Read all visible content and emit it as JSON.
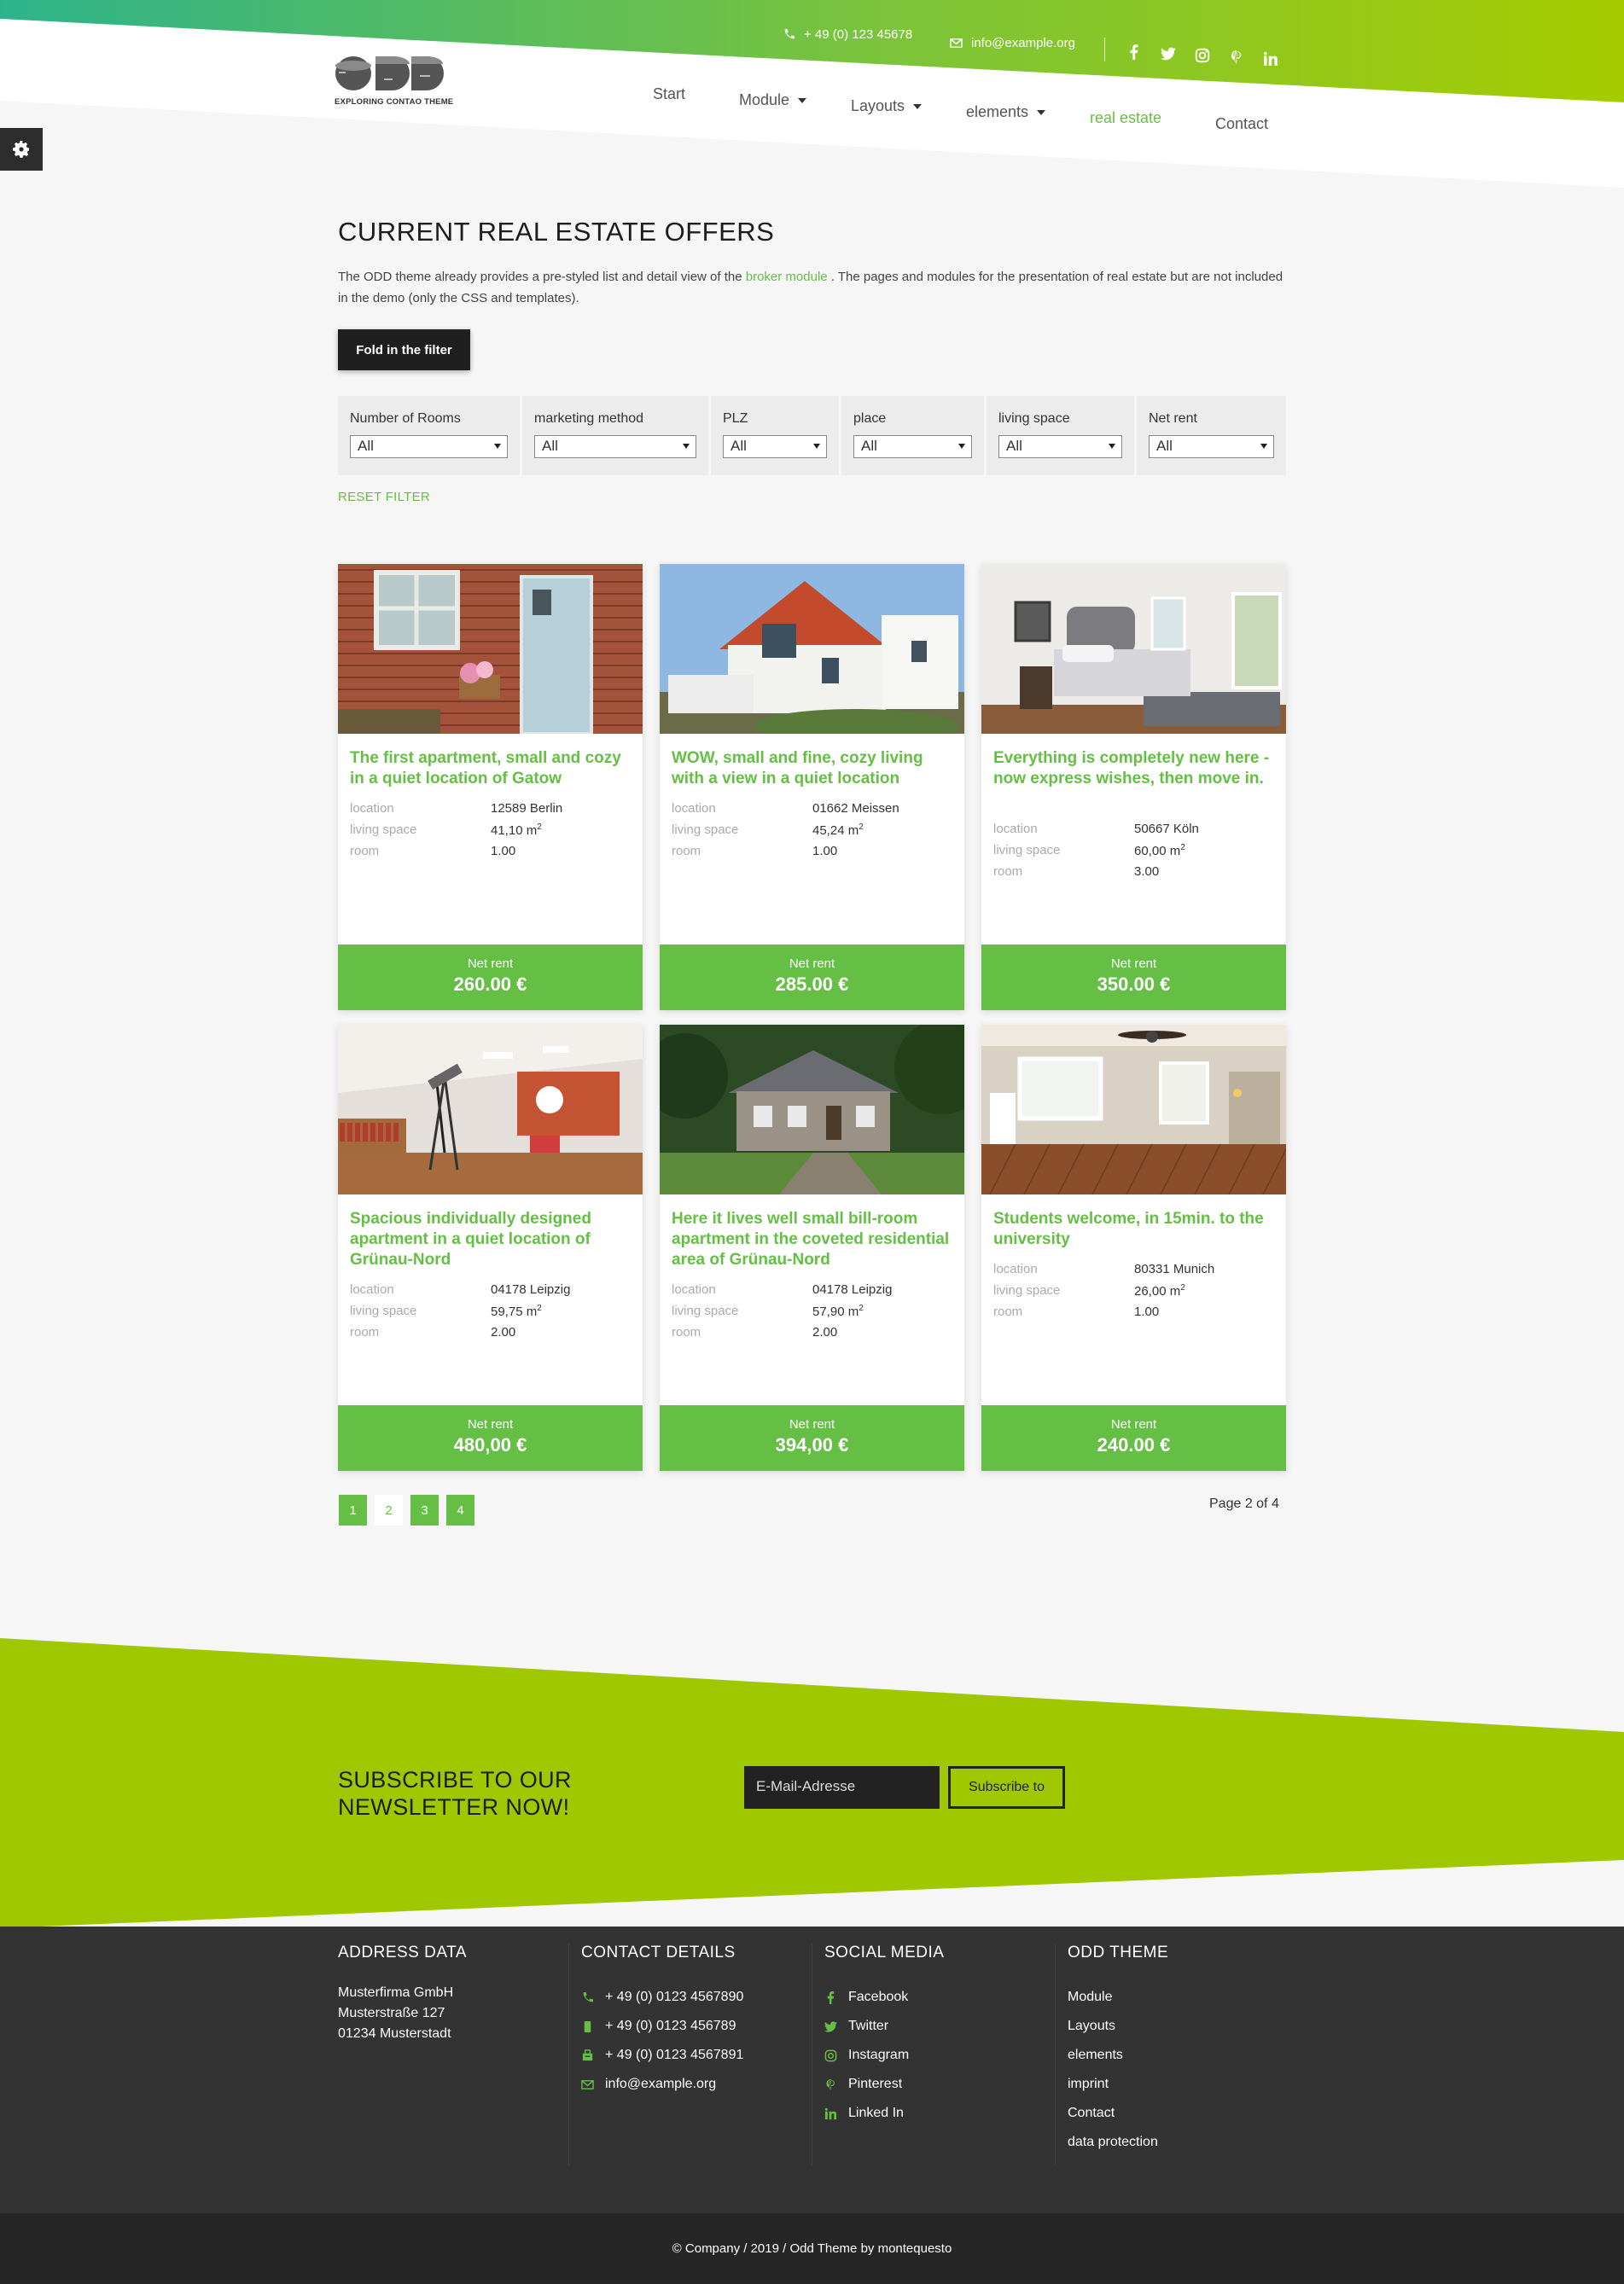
{
  "colors": {
    "accent": "#66bf45",
    "lime": "#a0c800",
    "teal": "#2db38b",
    "dark": "#333333"
  },
  "topbar": {
    "phone": "+ 49 (0) 123 45678",
    "email": "info@example.org",
    "social": [
      "facebook-icon",
      "twitter-icon",
      "instagram-icon",
      "pinterest-icon",
      "linkedin-icon"
    ]
  },
  "logo": {
    "text": "ODD",
    "subtitle": "EXPLORING CONTAO THEME"
  },
  "nav": {
    "start": "Start",
    "module": "Module",
    "layouts": "Layouts",
    "elements": "elements",
    "real_estate": "real estate",
    "contact": "Contact"
  },
  "main": {
    "title": "CURRENT REAL ESTATE OFFERS",
    "intro_before": "The ODD theme already provides a pre-styled list and detail view of the ",
    "intro_link": "broker module",
    "intro_after": " . The pages and modules for the presentation of real estate but are not included in the demo (only the CSS and templates).",
    "fold_button": "Fold in the filter",
    "reset": "RESET FILTER"
  },
  "filters": [
    {
      "label": "Number of Rooms",
      "value": "All"
    },
    {
      "label": "marketing method",
      "value": "All"
    },
    {
      "label": "PLZ",
      "value": "All"
    },
    {
      "label": "place",
      "value": "All"
    },
    {
      "label": "living space",
      "value": "All"
    },
    {
      "label": "Net rent",
      "value": "All"
    }
  ],
  "labels": {
    "location": "location",
    "living_space": "living space",
    "room": "room",
    "net_rent": "Net rent"
  },
  "listings": [
    {
      "title": "The first apartment, small and cozy in a quiet location of Gatow",
      "location": "12589 Berlin",
      "space": "41,10 m",
      "room": "1.00",
      "price": "260.00 €"
    },
    {
      "title": "WOW, small and fine, cozy living with a view in a quiet location",
      "location": "01662 Meissen",
      "space": "45,24 m",
      "room": "1.00",
      "price": "285.00 €"
    },
    {
      "title": "Everything is completely new here - now express wishes, then move in.",
      "location": "50667 Köln",
      "space": "60,00 m",
      "room": "3.00",
      "price": "350.00 €"
    },
    {
      "title": "Spacious individually designed apartment in a quiet location of Grünau-Nord",
      "location": "04178 Leipzig",
      "space": "59,75 m",
      "room": "2.00",
      "price": "480,00 €"
    },
    {
      "title": "Here it lives well small bill-room apartment in the coveted residential area of Grünau-Nord",
      "location": "04178 Leipzig",
      "space": "57,90 m",
      "room": "2.00",
      "price": "394,00 €"
    },
    {
      "title": "Students welcome, in 15min. to the university",
      "location": "80331 Munich",
      "space": "26,00 m",
      "room": "1.00",
      "price": "240.00 €"
    }
  ],
  "sq": "2",
  "pagination": {
    "pages": [
      "1",
      "2",
      "3",
      "4"
    ],
    "current": "2",
    "info": "Page 2 of 4"
  },
  "newsletter": {
    "title": "SUBSCRIBE TO OUR NEWSLETTER NOW!",
    "placeholder": "E-Mail-Adresse",
    "button": "Subscribe to"
  },
  "footer": {
    "address": {
      "title": "ADDRESS DATA",
      "lines": [
        "Musterfirma GmbH",
        "Musterstraße 127",
        "01234 Musterstadt"
      ]
    },
    "contact": {
      "title": "CONTACT DETAILS",
      "phone": "+ 49 (0) 0123 4567890",
      "mobile": "+ 49 (0) 0123 456789",
      "fax": "+ 49 (0) 0123 4567891",
      "email": "info@example.org"
    },
    "social": {
      "title": "SOCIAL MEDIA",
      "items": [
        "Facebook",
        "Twitter",
        "Instagram",
        "Pinterest",
        "Linked In"
      ]
    },
    "odd": {
      "title": "ODD THEME",
      "items": [
        "Module",
        "Layouts",
        "elements",
        "imprint",
        "Contact",
        "data protection"
      ]
    }
  },
  "copyright": "© Company / 2019 / Odd Theme by montequesto"
}
